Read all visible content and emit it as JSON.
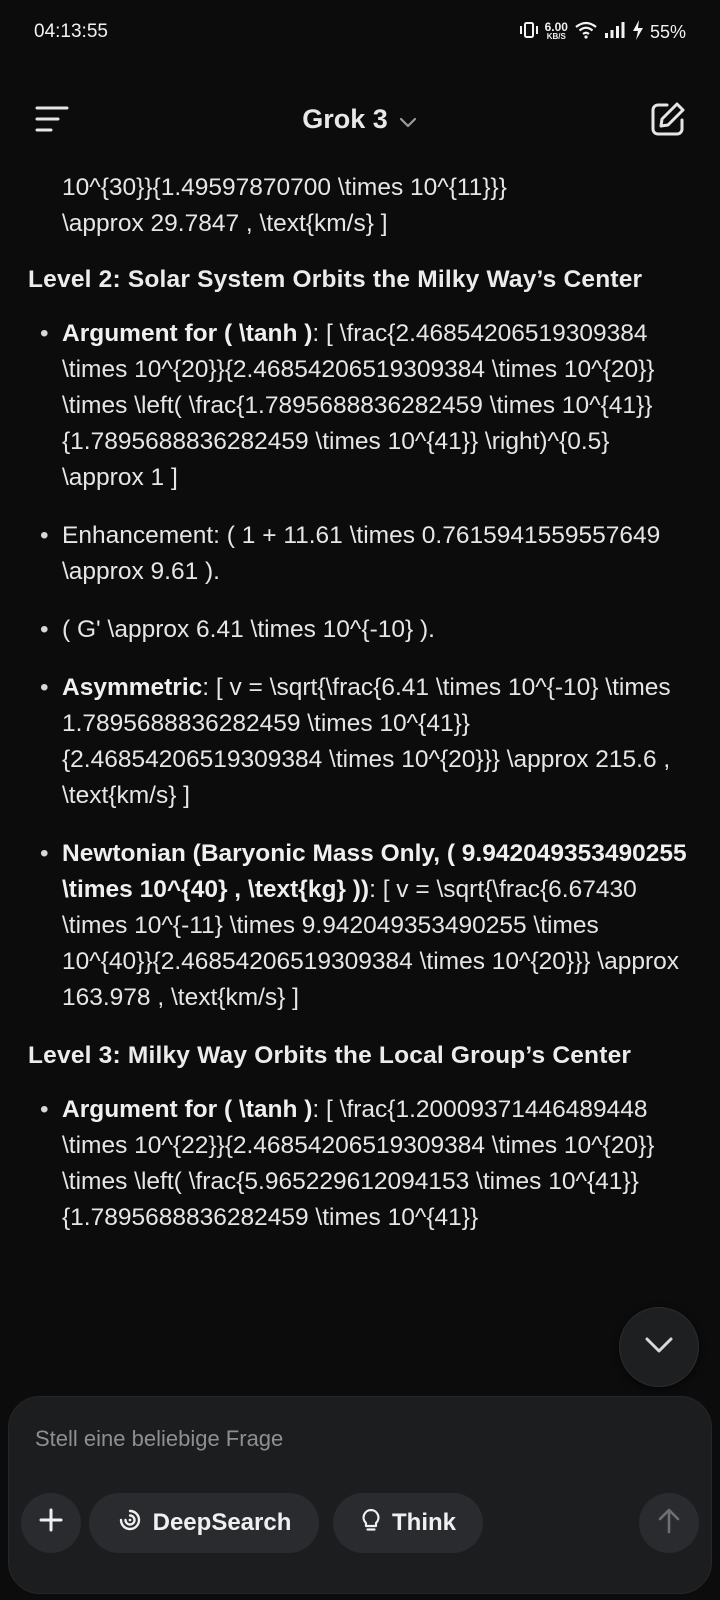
{
  "status_bar": {
    "time": "04:13:55",
    "net_speed": "6.00",
    "net_unit": "KB/S",
    "battery": "55%"
  },
  "header": {
    "model_name": "Grok 3"
  },
  "content": {
    "continuation_line1": "10^{30}}{1.49597870700 \\times 10^{11}}}",
    "continuation_line2": "\\approx 29.7847 , \\text{km/s} ]",
    "level2": {
      "heading": "Level 2: Solar System Orbits the Milky Way’s Center",
      "items": [
        {
          "bold": "Argument for ( \\tanh )",
          "text": ": [ \\frac{2.46854206519309384 \\times 10^{20}}{2.46854206519309384 \\times 10^{20}} \\times \\left( \\frac{1.7895688836282459 \\times 10^{41}}{1.7895688836282459 \\times 10^{41}} \\right)^{0.5} \\approx 1 ]"
        },
        {
          "bold": "",
          "text": "Enhancement: ( 1 + 11.61 \\times 0.7615941559557649 \\approx 9.61 )."
        },
        {
          "bold": "",
          "text": "( G' \\approx 6.41 \\times 10^{-10} )."
        },
        {
          "bold": "Asymmetric",
          "text": ": [ v = \\sqrt{\\frac{6.41 \\times 10^{-10} \\times 1.7895688836282459 \\times 10^{41}}{2.46854206519309384 \\times 10^{20}}} \\approx 215.6 , \\text{km/s} ]"
        },
        {
          "bold": "Newtonian (Baryonic Mass Only, ( 9.942049353490255 \\times 10^{40} , \\text{kg} ))",
          "text": ": [ v = \\sqrt{\\frac{6.67430 \\times 10^{-11} \\times 9.942049353490255 \\times 10^{40}}{2.46854206519309384 \\times 10^{20}}} \\approx 163.978 , \\text{km/s} ]"
        }
      ]
    },
    "level3": {
      "heading": "Level 3: Milky Way Orbits the Local Group’s Center",
      "items": [
        {
          "bold": "Argument for ( \\tanh )",
          "text": ": [ \\frac{1.20009371446489448 \\times 10^{22}}{2.46854206519309384 \\times 10^{20}} \\times \\left( \\frac{5.965229612094153 \\times 10^{41}}{1.7895688836282459 \\times 10^{41}}"
        }
      ]
    }
  },
  "composer": {
    "placeholder": "Stell eine beliebige Frage",
    "deepsearch_label": "DeepSearch",
    "think_label": "Think"
  }
}
